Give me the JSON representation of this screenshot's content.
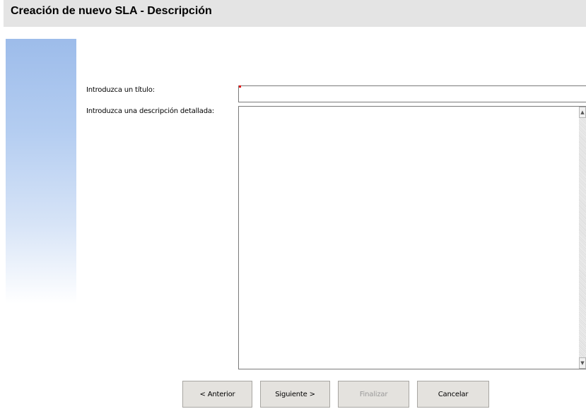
{
  "header": {
    "title": "Creación de nuevo SLA - Descripción"
  },
  "form": {
    "title_label": "Introduzca un título:",
    "title_value": "",
    "description_label": "Introduzca una descripción detallada:",
    "description_value": ""
  },
  "buttons": {
    "previous": "< Anterior",
    "next": "Siguiente >",
    "finish": "Finalizar",
    "cancel": "Cancelar"
  },
  "icons": {
    "scroll_up": "scroll-up-arrow-icon",
    "scroll_down": "scroll-down-arrow-icon"
  },
  "colors": {
    "header_bg": "#e4e4e4",
    "side_panel": "#9dbcea",
    "required_marker": "#e00000",
    "button_bg": "#e4e2de"
  }
}
